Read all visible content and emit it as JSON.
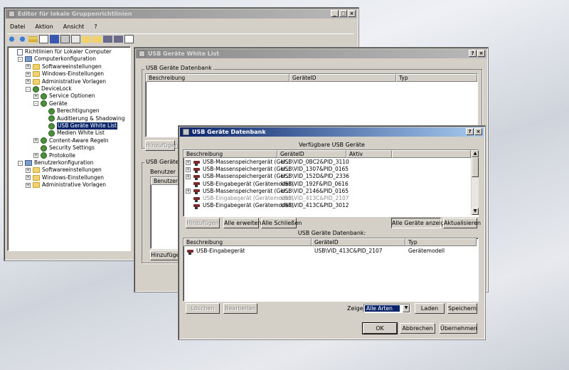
{
  "gpedit": {
    "title": "Editor für lokale Gruppenrichtlinien",
    "menu": [
      "Datei",
      "Aktion",
      "Ansicht",
      "?"
    ],
    "tree": [
      {
        "label": "Richtlinien für Lokaler Computer",
        "indent": 0,
        "exp": "",
        "icon": "doc"
      },
      {
        "label": "Computerkonfiguration",
        "indent": 1,
        "exp": "-",
        "icon": "pc"
      },
      {
        "label": "Softwareeinstellungen",
        "indent": 2,
        "exp": "+",
        "icon": "folder"
      },
      {
        "label": "Windows-Einstellungen",
        "indent": 2,
        "exp": "+",
        "icon": "folder"
      },
      {
        "label": "Administrative Vorlagen",
        "indent": 2,
        "exp": "+",
        "icon": "folder"
      },
      {
        "label": "DeviceLock",
        "indent": 2,
        "exp": "-",
        "icon": "gear"
      },
      {
        "label": "Service Optionen",
        "indent": 3,
        "exp": "+",
        "icon": "gear"
      },
      {
        "label": "Geräte",
        "indent": 3,
        "exp": "-",
        "icon": "gear"
      },
      {
        "label": "Berechtigungen",
        "indent": 4,
        "exp": "",
        "icon": "gear"
      },
      {
        "label": "Auditierung & Shadowing",
        "indent": 4,
        "exp": "",
        "icon": "gear"
      },
      {
        "label": "USB Geräte White List",
        "indent": 4,
        "exp": "",
        "icon": "gear",
        "selected": true
      },
      {
        "label": "Medien White List",
        "indent": 4,
        "exp": "",
        "icon": "gear"
      },
      {
        "label": "Content-Aware Regeln",
        "indent": 3,
        "exp": "+",
        "icon": "gear"
      },
      {
        "label": "Security Settings",
        "indent": 3,
        "exp": "",
        "icon": "gear"
      },
      {
        "label": "Protokolle",
        "indent": 3,
        "exp": "+",
        "icon": "gear"
      },
      {
        "label": "Benutzerkonfiguration",
        "indent": 1,
        "exp": "-",
        "icon": "pc"
      },
      {
        "label": "Softwareeinstellungen",
        "indent": 2,
        "exp": "+",
        "icon": "folder"
      },
      {
        "label": "Windows-Einstellungen",
        "indent": 2,
        "exp": "+",
        "icon": "folder"
      },
      {
        "label": "Administrative Vorlagen",
        "indent": 2,
        "exp": "+",
        "icon": "folder"
      }
    ]
  },
  "whitelist": {
    "title": "USB Geräte White List",
    "group_label": "USB Geräte Datenbank",
    "headers": [
      "Beschreibung",
      "GeräteID",
      "Typ"
    ],
    "btn_add": "Hinzufügen",
    "group2_label": "USB Geräte W",
    "users_label": "Benutzer",
    "users_header": "Benutzer",
    "btn_add2": "Hinzufügen"
  },
  "dialog": {
    "title": "USB Geräte Datenbank",
    "available_label": "Verfügbare USB Geräte",
    "avail_headers": [
      "Beschreibung",
      "GeräteID",
      "Aktiv"
    ],
    "devices": [
      {
        "desc": "USB-Massenspeichergerät (Ger...",
        "id": "USB\\VID_0BC2&PID_3110",
        "exp": "+",
        "gray": false
      },
      {
        "desc": "USB-Massenspeichergerät (Ger...",
        "id": "USB\\VID_1307&PID_0165",
        "exp": "+",
        "gray": false
      },
      {
        "desc": "USB-Massenspeichergerät (Ger...",
        "id": "USB\\VID_152D&PID_2336",
        "exp": "+",
        "gray": false
      },
      {
        "desc": "USB-Eingabegerät (Gerätemodell)",
        "id": "USB\\VID_192F&PID_0616",
        "exp": "",
        "gray": false
      },
      {
        "desc": "USB-Massenspeichergerät (Ger...",
        "id": "USB\\VID_2146&PID_0165",
        "exp": "+",
        "gray": false
      },
      {
        "desc": "USB-Eingabegerät (Gerätemodell)",
        "id": "USB\\VID_413C&PID_2107",
        "exp": "",
        "gray": true
      },
      {
        "desc": "USB-Eingabegerät (Gerätemodell)",
        "id": "USB\\VID_413C&PID_3012",
        "exp": "",
        "gray": false
      }
    ],
    "btn_add": "Hinzufügen",
    "btn_expand": "Alle erweitern",
    "btn_close_all": "Alle Schließen",
    "btn_show_all": "Alle Geräte anzeigen",
    "btn_refresh": "Aktualisieren",
    "db_label": "USB Geräte Datenbank:",
    "db_headers": [
      "Beschreibung",
      "GeräteID",
      "Typ"
    ],
    "db_rows": [
      {
        "desc": "USB-Eingabegerät",
        "id": "USB\\VID_413C&PID_2107",
        "type": "Gerätemodell"
      }
    ],
    "btn_delete": "Löschen",
    "btn_edit": "Bearbeiten",
    "show_label": "Zeige:",
    "show_value": "Alle Arten",
    "btn_load": "Laden",
    "btn_save": "Speichern",
    "btn_ok": "OK",
    "btn_cancel": "Abbrechen",
    "btn_apply": "Übernehmen"
  }
}
